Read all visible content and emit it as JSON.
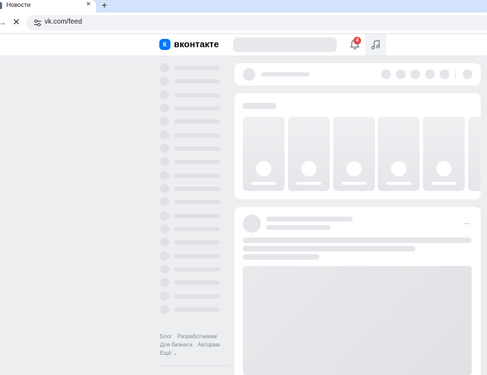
{
  "browser": {
    "tab_title": "Новости",
    "tab_close": "×",
    "new_tab": "+",
    "url": "vk.com/feed",
    "stop_glyph": "✕",
    "forward_glyph": "→"
  },
  "header": {
    "logo_mark": "К",
    "logo_text": "вконтакте",
    "notifications_count": "4"
  },
  "sidebar": {
    "footer_links": [
      "Блог",
      "Разработчикам",
      "Для бизнеса",
      "Авторам",
      "Ещё ⌄"
    ]
  },
  "colors": {
    "brand": "#0077ff",
    "badge": "#e64646",
    "page_bg": "#edeef0",
    "skeleton": "#e4e6ea"
  }
}
